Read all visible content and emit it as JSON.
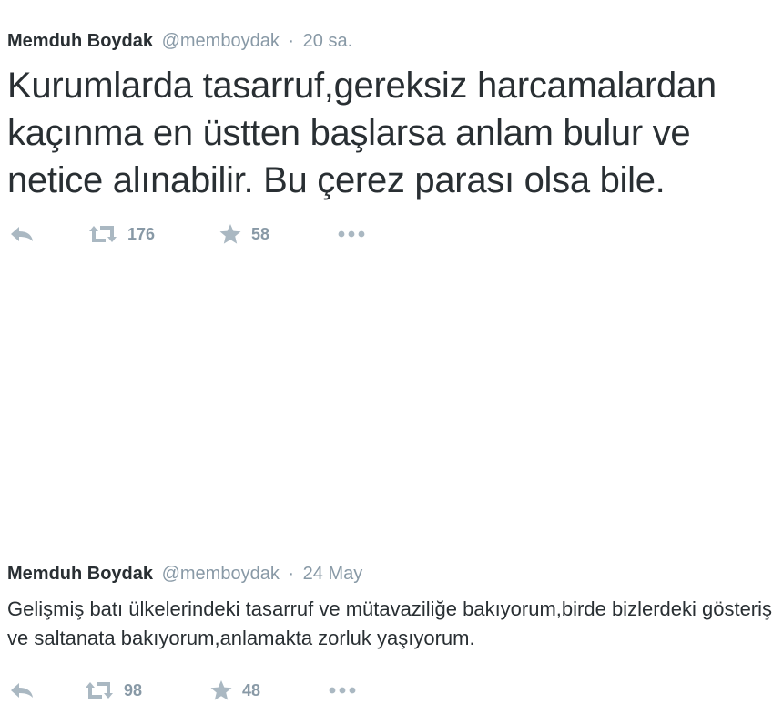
{
  "tweets": [
    {
      "author_name": "Memduh Boydak",
      "handle": "@memboydak",
      "separator": "·",
      "time": "20 sa.",
      "text": "Kurumlarda tasarruf,gereksiz harcamalardan kaçınma en üstten başlarsa anlam bulur ve netice alınabilir. Bu çerez parası olsa bile.",
      "actions": {
        "reply_icon": "reply-icon",
        "retweet_count": "176",
        "favorite_count": "58",
        "more_icon": "more-icon"
      }
    },
    {
      "author_name": "Memduh Boydak",
      "handle": "@memboydak",
      "separator": "·",
      "time": "24 May",
      "text": "Gelişmiş batı ülkelerindeki tasarruf ve mütavaziliğe bakıyorum,birde bizlerdeki gösteriş ve saltanata bakıyorum,anlamakta zorluk yaşıyorum.",
      "actions": {
        "reply_icon": "reply-icon",
        "retweet_count": "98",
        "favorite_count": "48",
        "more_icon": "more-icon"
      }
    }
  ],
  "colors": {
    "text": "#292f33",
    "secondary": "#8899a6",
    "icon": "#aab8c2",
    "divider": "#e1e8ed"
  }
}
